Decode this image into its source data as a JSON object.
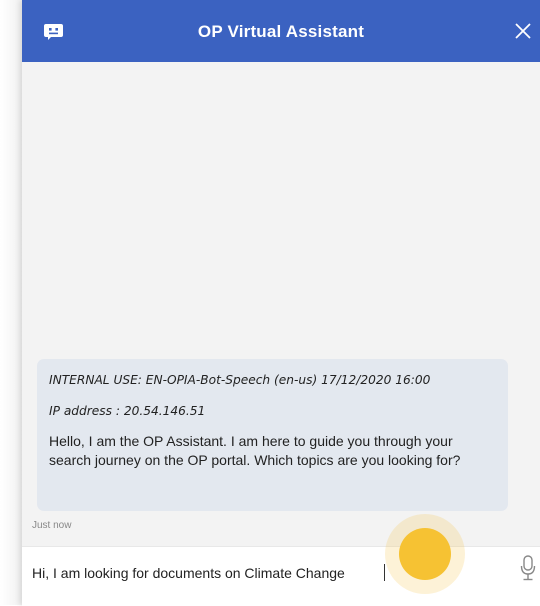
{
  "header": {
    "title": "OP Virtual Assistant",
    "background": "#3b62c1",
    "bot_icon": "chat-bot-icon",
    "close_icon": "close-icon"
  },
  "messages": [
    {
      "sender": "bot",
      "internal_line": "INTERNAL USE: EN-OPIA-Bot-Speech (en-us) 17/12/2020 16:00",
      "ip_line": "IP address : 20.54.146.51",
      "text": "Hello, I am the OP Assistant. I am here to guide you through your search journey on the OP portal. Which topics are you looking for?",
      "timestamp": "Just now"
    }
  ],
  "composer": {
    "value": "Hi, I am looking for documents on Climate Change",
    "mic_icon": "microphone-icon"
  },
  "colors": {
    "bubble": "#e3e8ef",
    "chat_background": "#f3f3f3",
    "click_highlight": "#f6c233"
  }
}
